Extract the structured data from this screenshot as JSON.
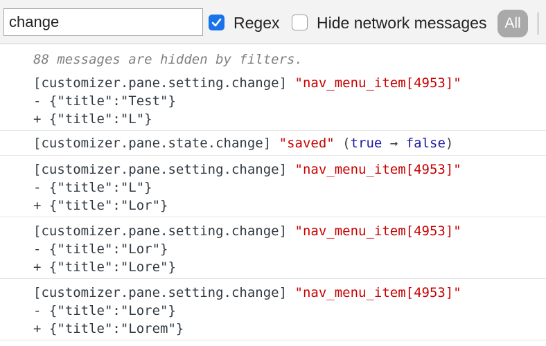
{
  "filter": {
    "value": "change",
    "regex_checked": true,
    "regex_label": "Regex",
    "hide_network_checked": false,
    "hide_network_label": "Hide network messages",
    "all_label": "All"
  },
  "console": {
    "hidden_note": "88 messages are hidden by filters.",
    "entries": [
      {
        "event": "[customizer.pane.setting.change]",
        "target": "\"nav_menu_item[4953]\"",
        "minus": "- {\"title\":\"Test\"}",
        "plus": "+ {\"title\":\"L\"}"
      },
      {
        "event": "[customizer.pane.state.change]",
        "target": "\"saved\"",
        "open": "(",
        "from": "true",
        "arrow": " → ",
        "to": "false",
        "close": ")"
      },
      {
        "event": "[customizer.pane.setting.change]",
        "target": "\"nav_menu_item[4953]\"",
        "minus": "- {\"title\":\"L\"}",
        "plus": "+ {\"title\":\"Lor\"}"
      },
      {
        "event": "[customizer.pane.setting.change]",
        "target": "\"nav_menu_item[4953]\"",
        "minus": "- {\"title\":\"Lor\"}",
        "plus": "+ {\"title\":\"Lore\"}"
      },
      {
        "event": "[customizer.pane.setting.change]",
        "target": "\"nav_menu_item[4953]\"",
        "minus": "- {\"title\":\"Lore\"}",
        "plus": "+ {\"title\":\"Lorem\"}"
      }
    ]
  },
  "colors": {
    "string": "#c80000",
    "keyword": "#1a1aa6",
    "checkbox_accent": "#1a73e8"
  }
}
